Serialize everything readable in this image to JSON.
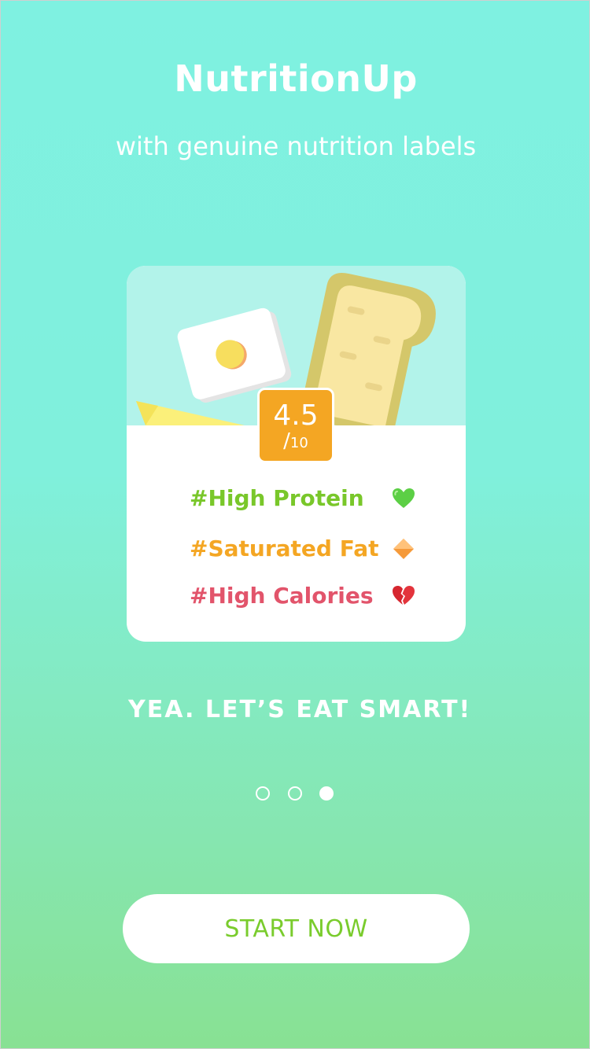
{
  "header": {
    "title": "NutritionUp",
    "subtitle": "with genuine nutrition labels"
  },
  "card": {
    "score": {
      "value": "4.5",
      "slash": "/",
      "max": "10"
    },
    "tags": [
      {
        "label": "#High Protein",
        "color": "#79c72a",
        "icon": "green-heart-icon"
      },
      {
        "label": "#Saturated Fat",
        "color": "#f4a623",
        "icon": "orange-diamond-icon"
      },
      {
        "label": "#High Calories",
        "color": "#e2546b",
        "icon": "broken-heart-icon"
      }
    ]
  },
  "tagline": "YEA. LET’S EAT SMART!",
  "pager": {
    "count": 3,
    "active_index": 2
  },
  "cta": {
    "label": "START NOW"
  },
  "colors": {
    "background_top": "#7ff1e1",
    "background_bottom": "#88e193",
    "badge": "#f4a623",
    "cta_text": "#7acc2d"
  }
}
